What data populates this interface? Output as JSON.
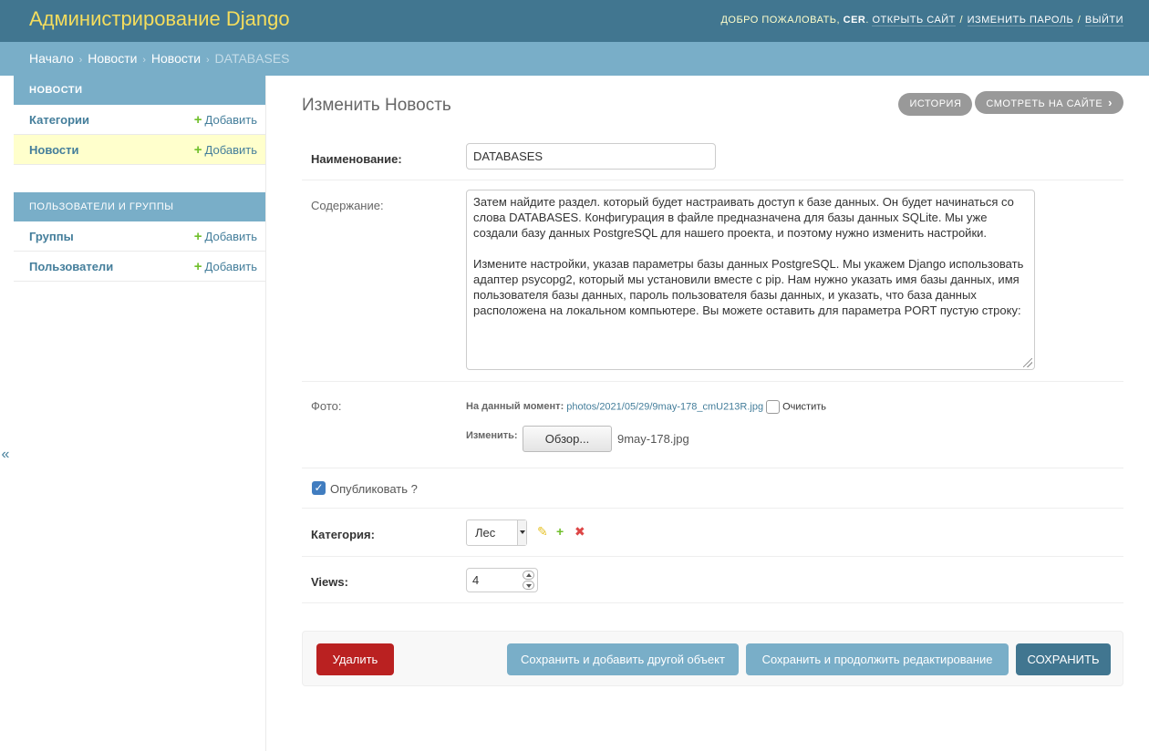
{
  "header": {
    "branding": "Администрирование Django",
    "welcome": "ДОБРО ПОЖАЛОВАТЬ,",
    "username": "CER",
    "view_site": "ОТКРЫТЬ САЙТ",
    "change_password": "ИЗМЕНИТЬ ПАРОЛЬ",
    "logout": "ВЫЙТИ",
    "separator": "/"
  },
  "breadcrumbs": {
    "separator": "›",
    "items": [
      "Начало",
      "Новости",
      "Новости"
    ],
    "current": "DATABASES"
  },
  "sidebar": {
    "modules": [
      {
        "caption": "Новости",
        "models": [
          {
            "name": "Категории",
            "add": "Добавить"
          },
          {
            "name": "Новости",
            "add": "Добавить"
          }
        ]
      },
      {
        "caption": "Пользователи и группы",
        "models": [
          {
            "name": "Группы",
            "add": "Добавить"
          },
          {
            "name": "Пользователи",
            "add": "Добавить"
          }
        ]
      }
    ],
    "add_icon": "plus-icon",
    "toggle": "«"
  },
  "page": {
    "title": "Изменить Новость",
    "history": "ИСТОРИЯ",
    "view_on_site": "СМОТРЕТЬ НА САЙТЕ"
  },
  "form": {
    "title_label": "Наименование:",
    "title_value": "DATABASES",
    "content_label": "Содержание:",
    "content_p1": "Затем найдите раздел. который будет настраивать доступ к базе данных. Он будет начинаться со слова DATABASES. Конфигурация в файле предназначена для базы данных SQLite. Мы уже создали базу данных PostgreSQL для нашего проекта, и поэтому нужно изменить настройки.",
    "content_p2": "Измените настройки, указав параметры базы данных PostgreSQL. Мы укажем Django использовать адаптер psycopg2, который мы установили вместе с pip. Нам нужно указать имя базы данных, имя пользователя базы данных, пароль пользователя базы данных, и указать, что база данных расположена на локальном компьютере. Вы можете оставить для параметра PORT пустую строку:",
    "photo_label": "Фото:",
    "photo_current_label": "На данный момент:",
    "photo_current_link": "photos/2021/05/29/9may-178_cmU213R.jpg",
    "photo_clear": "Очистить",
    "photo_change_label": "Изменить:",
    "photo_browse": "Обзор...",
    "photo_filename": "9may-178.jpg",
    "published_label": "Опубликовать ?",
    "published_checked": true,
    "category_label": "Категория:",
    "category_value": "Лес",
    "views_label": "Views:",
    "views_value": "4"
  },
  "submit": {
    "delete": "Удалить",
    "save_add_another": "Сохранить и добавить другой объект",
    "save_continue": "Сохранить и продолжить редактирование",
    "save": "СОХРАНИТЬ"
  },
  "colors": {
    "header": "#417690",
    "branding": "#f5dd5d",
    "breadcrumbs": "#79aec8",
    "link": "#447e9b",
    "add_plus": "#70bf2b",
    "delete": "#ba2121",
    "current_row": "#ffffcc"
  }
}
